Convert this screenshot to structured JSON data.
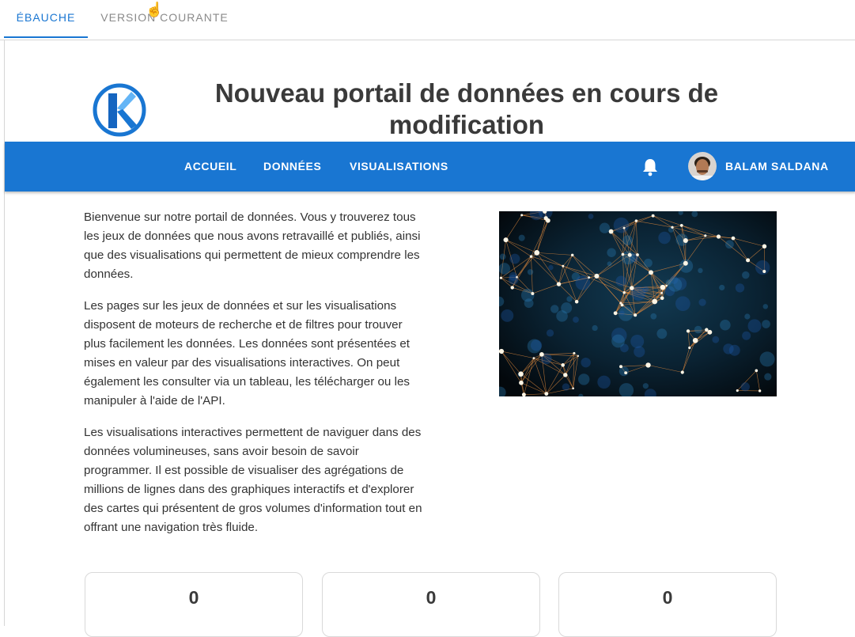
{
  "tabs": {
    "draft": "ÉBAUCHE",
    "current": "VERSION COURANTE"
  },
  "header": {
    "title": "Nouveau portail de données en cours de modification",
    "logo": "portal-logo-k",
    "accent_color": "#1976d2"
  },
  "nav": {
    "home": "ACCUEIL",
    "data": "DONNÉES",
    "visualizations": "VISUALISATIONS",
    "notifications_icon": "bell-icon",
    "user_name": "BALAM SALDANA"
  },
  "intro": {
    "p1": "Bienvenue sur notre portail de données. Vous y trouverez tous les jeux de données que nous avons retravaillé et publiés, ainsi que des visualisations qui permettent de mieux comprendre les données.",
    "p2": "Les pages sur les jeux de données et sur les visualisations disposent de moteurs de recherche et de filtres pour trouver plus facilement les données. Les données sont présentées et mises en valeur par des visualisations interactives. On peut également les consulter via un tableau, les télécharger ou les manipuler à l'aide de l'API.",
    "p3": "Les visualisations interactives permettent de naviguer dans des données volumineuses, sans avoir besoin de savoir programmer. Il est possible de visualiser des agrégations de millions de lignes dans des graphiques interactifs et d'explorer des cartes qui présentent de gros volumes d'information tout en offrant une navigation très fluide."
  },
  "metrics": [
    "0",
    "0",
    "0"
  ]
}
